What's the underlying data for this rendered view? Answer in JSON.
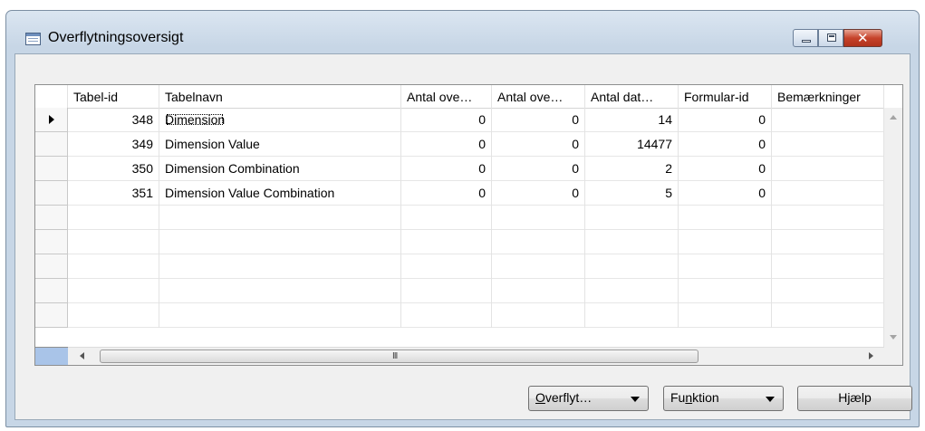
{
  "window": {
    "title": "Overflytningsoversigt"
  },
  "columns": [
    "Tabel-id",
    "Tabelnavn",
    "Antal ove…",
    "Antal ove…",
    "Antal dat…",
    "Formular-id",
    "Bemærkninger"
  ],
  "rows": [
    {
      "id": "348",
      "name": "Dimension",
      "c3": "0",
      "c4": "0",
      "c5": "14",
      "c6": "0",
      "c7": ""
    },
    {
      "id": "349",
      "name": "Dimension Value",
      "c3": "0",
      "c4": "0",
      "c5": "14477",
      "c6": "0",
      "c7": ""
    },
    {
      "id": "350",
      "name": "Dimension Combination",
      "c3": "0",
      "c4": "0",
      "c5": "2",
      "c6": "0",
      "c7": ""
    },
    {
      "id": "351",
      "name": "Dimension Value Combination",
      "c3": "0",
      "c4": "0",
      "c5": "5",
      "c6": "0",
      "c7": ""
    }
  ],
  "buttons": {
    "overflyt": {
      "mnemonic": "O",
      "rest": "verflyt…"
    },
    "funktion": {
      "pre": "Fu",
      "mnemonic": "n",
      "rest": "ktion"
    },
    "hjaelp": "Hjælp"
  },
  "scroll": {
    "grip": "III"
  }
}
